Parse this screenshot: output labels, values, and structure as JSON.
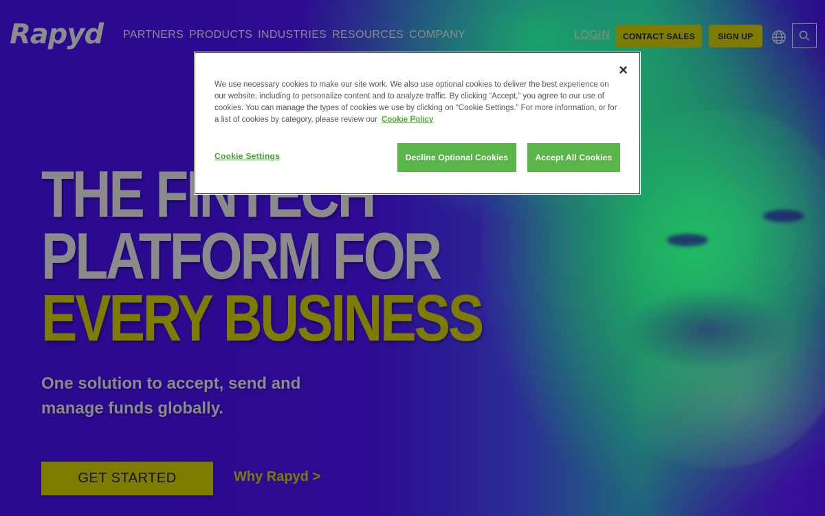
{
  "header": {
    "logo": "Rapyd",
    "nav": [
      "PARTNERS",
      "PRODUCTS",
      "INDUSTRIES",
      "RESOURCES",
      "COMPANY"
    ],
    "login": "LOGIN",
    "contact_sales": "CONTACT SALES",
    "sign_up": "SIGN UP"
  },
  "hero": {
    "headline_line1": "THE FINTECH",
    "headline_line2": "PLATFORM FOR",
    "headline_line3": "EVERY BUSINESS",
    "subtitle": "One solution to accept, send and manage funds globally.",
    "get_started": "GET STARTED",
    "why_rapyd": "Why Rapyd >"
  },
  "cookie_modal": {
    "close": "×",
    "text": "We use necessary cookies to make our site work. We also use optional cookies to deliver the best experience on our website, including to personalize content and to analyze traffic. By clicking “Accept,” you agree to our use of cookies. You can manage the types of cookies we use by clicking on “Cookie Settings.” For more information, or for a list of cookies by category, please review our",
    "policy_link": "Cookie Policy",
    "cookie_settings": "Cookie Settings",
    "decline": "Decline Optional Cookies",
    "accept": "Accept All Cookies"
  },
  "colors": {
    "brand_yellow": "#7e7c00",
    "cookie_green": "#5ab54b",
    "background_purple": "#2b0a8c",
    "muted_grey": "#8a8a8a"
  }
}
